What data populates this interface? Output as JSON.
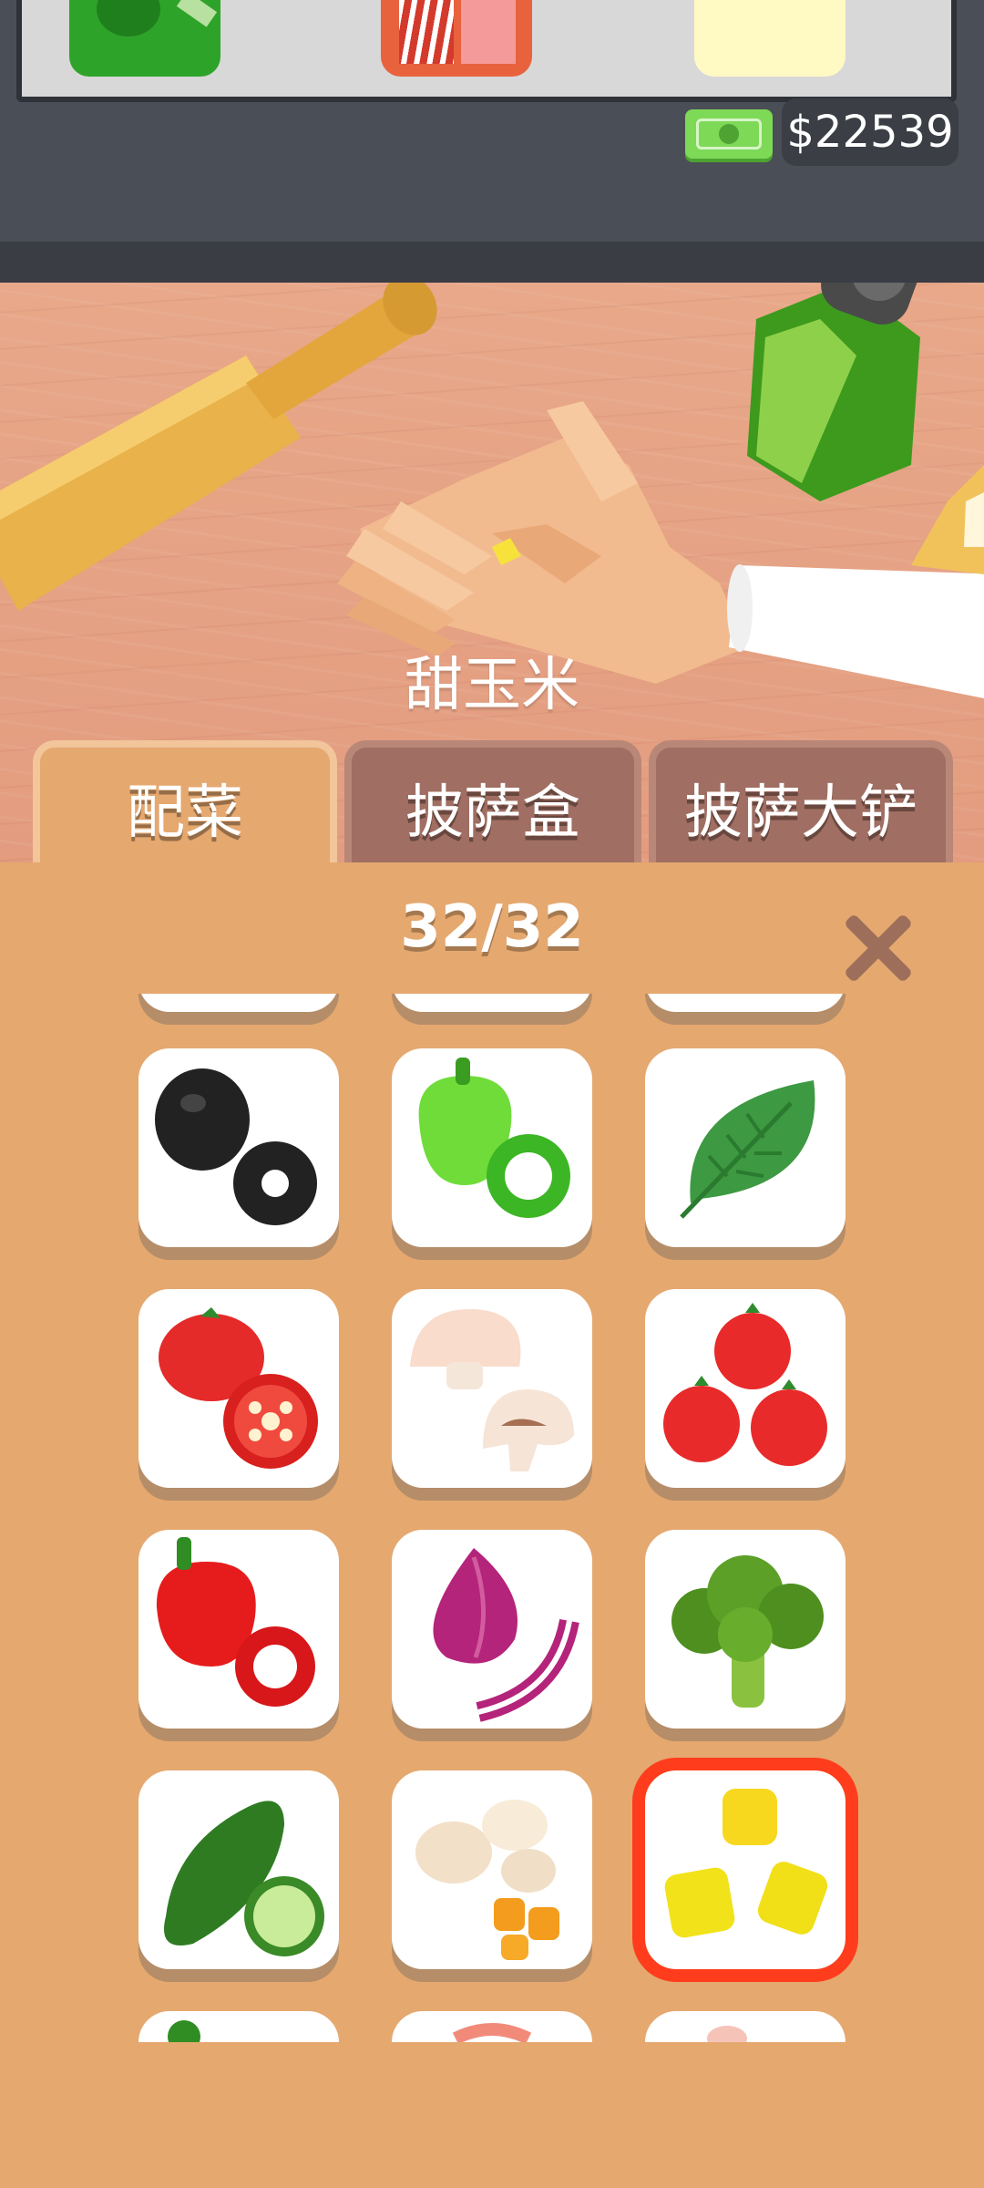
{
  "wallet": {
    "amount": "$22539",
    "icon": "money-icon"
  },
  "table": {
    "selected_ingredient": "甜玉米"
  },
  "tabs": [
    {
      "label": "配菜",
      "active": true
    },
    {
      "label": "披萨盒",
      "active": false
    },
    {
      "label": "披萨大铲",
      "active": false
    }
  ],
  "panel": {
    "count": "32/32",
    "close_icon": "close-icon"
  },
  "ingredients": [
    "olives",
    "green-pepper",
    "basil",
    "tomato",
    "mushroom",
    "cherry-tomatoes",
    "red-pepper",
    "red-onion",
    "broccoli",
    "zucchini",
    "mixed-vegetables",
    "sweet-corn"
  ],
  "selected_ingredient_index": 11,
  "colors": {
    "panel": "#e5a86f",
    "selection": "#ff3d1d",
    "tab_inactive": "#a06e62",
    "money": "#7ed957"
  }
}
